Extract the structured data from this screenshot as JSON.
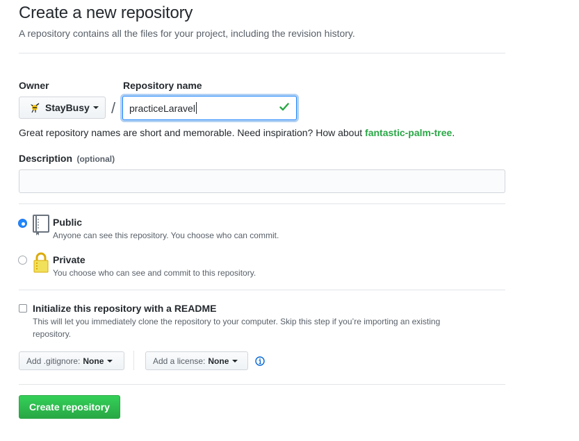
{
  "header": {
    "title": "Create a new repository",
    "subtitle": "A repository contains all the files for your project, including the revision history."
  },
  "owner": {
    "label": "Owner",
    "value": "StayBusy"
  },
  "repository": {
    "label": "Repository name",
    "value": "practiceLaravel",
    "separator": "/",
    "hint_text": "Great repository names are short and memorable. Need inspiration? How about ",
    "suggestion": "fantastic-palm-tree",
    "hint_end": "."
  },
  "description": {
    "label": "Description",
    "optional": "(optional)",
    "value": ""
  },
  "visibility": {
    "public": {
      "title": "Public",
      "desc": "Anyone can see this repository. You choose who can commit.",
      "selected": true
    },
    "private": {
      "title": "Private",
      "desc": "You choose who can see and commit to this repository.",
      "selected": false
    }
  },
  "init": {
    "title": "Initialize this repository with a README",
    "desc_line1": "This will let you immediately clone the repository to your computer. Skip this step if you’re importing an existing",
    "desc_line2": "repository.",
    "checked": false
  },
  "gitignore": {
    "label": "Add .gitignore:",
    "value": "None"
  },
  "license": {
    "label": "Add a license:",
    "value": "None"
  },
  "submit": {
    "label": "Create repository"
  },
  "colors": {
    "accent": "#2188ff",
    "success": "#28a745",
    "text": "#24292e",
    "muted": "#586069"
  }
}
